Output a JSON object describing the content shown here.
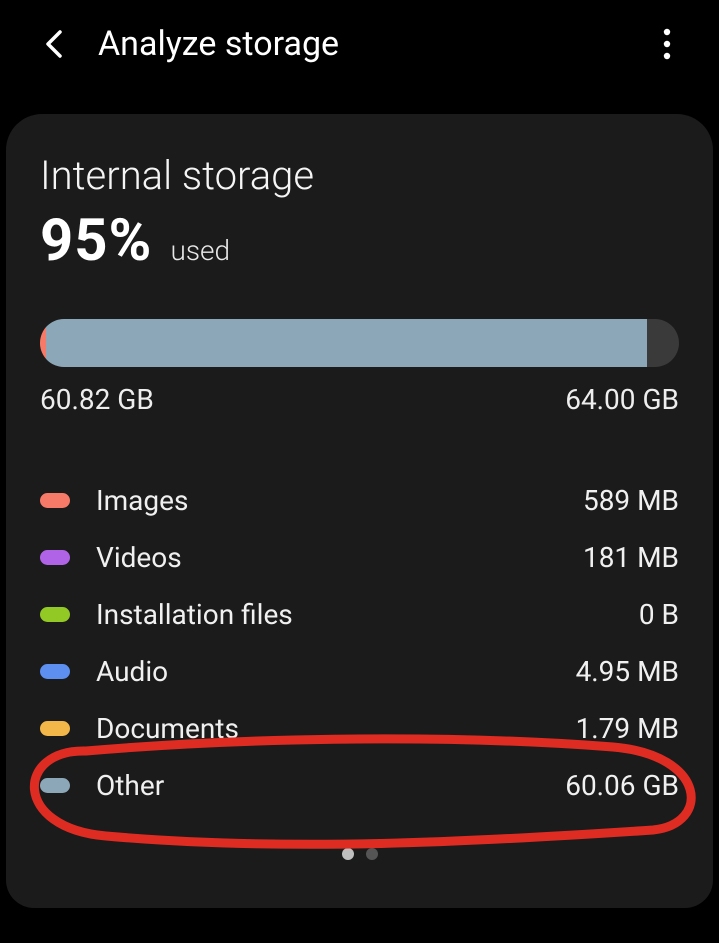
{
  "header": {
    "title": "Analyze storage"
  },
  "storage": {
    "title": "Internal storage",
    "percent": "95%",
    "used_label": "used",
    "used_size": "60.82 GB",
    "total_size": "64.00 GB",
    "progress_fill_percent": 95
  },
  "categories": [
    {
      "label": "Images",
      "size": "589 MB",
      "color": "#f77a69"
    },
    {
      "label": "Videos",
      "size": "181 MB",
      "color": "#b163e8"
    },
    {
      "label": "Installation files",
      "size": "0 B",
      "color": "#93c925"
    },
    {
      "label": "Audio",
      "size": "4.95 MB",
      "color": "#5c8ff0"
    },
    {
      "label": "Documents",
      "size": "1.79 MB",
      "color": "#f2b748"
    },
    {
      "label": "Other",
      "size": "60.06 GB",
      "color": "#8ca7b7"
    }
  ],
  "colors": {
    "track_bg": "#3a3a3a",
    "card_bg": "#1b1b1b",
    "annotation": "#de2c23",
    "dot_active": "#bfbfbf",
    "dot_inactive": "#555555"
  },
  "pagination": {
    "count": 2,
    "active_index": 0
  },
  "annotation": {
    "highlighted_category": "Other"
  }
}
